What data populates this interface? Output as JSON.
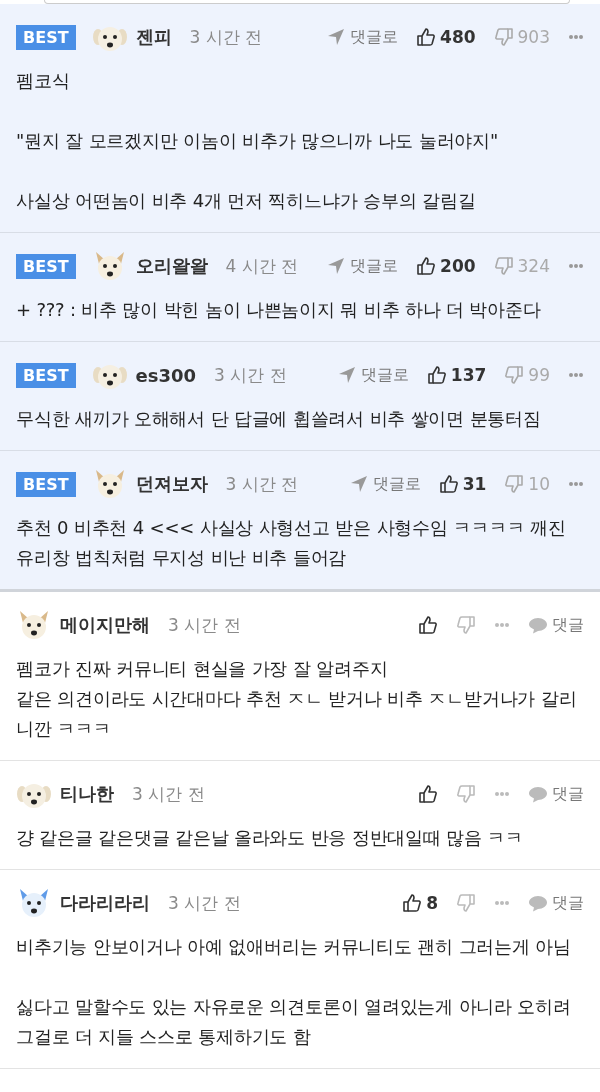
{
  "comments": [
    {
      "kind": "best",
      "badge": "BEST",
      "avatar": {
        "kind": "puppy"
      },
      "author": "젠피",
      "time": "3 시간 전",
      "reply_label": "댓글로",
      "likes": "480",
      "dislikes": "903",
      "body": "펨코식\n\n\"뭔지 잘 모르겠지만 이놈이 비추가 많으니까 나도 눌러야지\"\n\n사실상 어떤놈이 비추 4개 먼저 찍히느냐가 승부의 갈림길"
    },
    {
      "kind": "best",
      "badge": "BEST",
      "avatar": {
        "kind": "fox"
      },
      "author": "오리왈왈",
      "time": "4 시간 전",
      "reply_label": "댓글로",
      "likes": "200",
      "dislikes": "324",
      "body": "+ ??? : 비추 많이 박힌 놈이 나쁜놈이지 뭐 비추 하나 더 박아준다"
    },
    {
      "kind": "best",
      "badge": "BEST",
      "avatar": {
        "kind": "puppy"
      },
      "author": "es300",
      "time": "3 시간 전",
      "reply_label": "댓글로",
      "likes": "137",
      "dislikes": "99",
      "body": "무식한 새끼가 오해해서 단 답글에 휩쓸려서 비추 쌓이면 분통터짐"
    },
    {
      "kind": "best",
      "badge": "BEST",
      "avatar": {
        "kind": "fox"
      },
      "author": "던져보자",
      "time": "3 시간 전",
      "reply_label": "댓글로",
      "likes": "31",
      "dislikes": "10",
      "body": "추천 0 비추천 4 <<< 사실상 사형선고 받은 사형수임 ㅋㅋㅋㅋ 깨진 유리창 법칙처럼 무지성 비난 비추 들어감"
    },
    {
      "kind": "normal",
      "avatar": {
        "kind": "fox"
      },
      "author": "메이지만해",
      "time": "3 시간 전",
      "reply_label": "댓글",
      "body": "펨코가 진짜 커뮤니티 현실을 가장 잘 알려주지\n같은 의견이라도 시간대마다 추천 ㅈㄴ 받거나 비추 ㅈㄴ받거나가 갈리니깐 ㅋㅋㅋ"
    },
    {
      "kind": "normal",
      "avatar": {
        "kind": "puppy"
      },
      "author": "티나한",
      "time": "3 시간 전",
      "reply_label": "댓글",
      "body": "걍 같은글 같은댓글 같은날 올라와도 반응 정반대일때 많음 ㅋㅋ"
    },
    {
      "kind": "normal",
      "avatar": {
        "kind": "white-dog"
      },
      "author": "다라리라리",
      "time": "3 시간 전",
      "reply_label": "댓글",
      "likes": "8",
      "body": "비추기능 안보이거나 아예 없애버리는 커뮤니티도 괜히 그러는게 아님\n\n싫다고 말할수도 있는 자유로운 의견토론이 열려있는게 아니라 오히려 그걸로 더 지들 스스로 통제하기도 함"
    }
  ]
}
